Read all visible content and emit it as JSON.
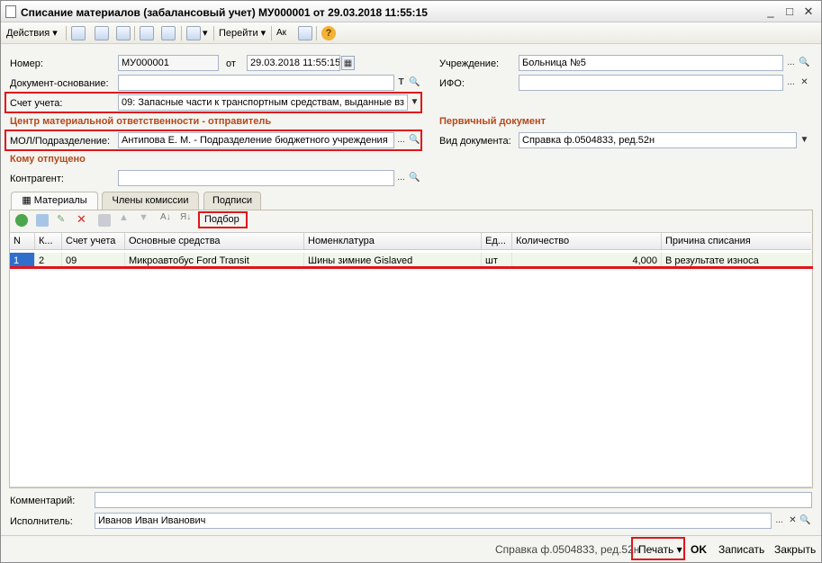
{
  "window": {
    "title": "Списание материалов (забалансовый учет) МУ000001 от 29.03.2018 11:55:15",
    "buttons": {
      "minimize": "_",
      "maximize": "□",
      "close": "✕"
    }
  },
  "toolbar": {
    "actions_label": "Действия",
    "goto_label": "Перейти",
    "help_icon": "?"
  },
  "form": {
    "number_label": "Номер:",
    "number_value": "МУ000001",
    "date_prefix": "от",
    "date_value": "29.03.2018 11:55:15",
    "base_doc_label": "Документ-основание:",
    "base_doc_value": "",
    "account_label": "Счет учета:",
    "account_value": "09: Запасные части к транспортным средствам, выданные вз",
    "sender_section": "Центр материальной ответственности - отправитель",
    "mol_label": "МОЛ/Подразделение:",
    "mol_value": "Антипова Е. М. - Подразделение бюджетного учреждения",
    "recipient_section": "Кому отпущено",
    "counterparty_label": "Контрагент:",
    "counterparty_value": "",
    "institution_label": "Учреждение:",
    "institution_value": "Больница №5",
    "ifo_label": "ИФО:",
    "ifo_value": "",
    "primary_section": "Первичный документ",
    "doc_type_label": "Вид документа:",
    "doc_type_value": "Справка ф.0504833, ред.52н",
    "comment_label": "Комментарий:",
    "comment_value": "",
    "executor_label": "Исполнитель:",
    "executor_value": "Иванов Иван Иванович"
  },
  "tabs": [
    {
      "label": "Материалы"
    },
    {
      "label": "Члены комиссии"
    },
    {
      "label": "Подписи"
    }
  ],
  "table_toolbar": {
    "pick_label": "Подбор"
  },
  "table": {
    "headers": [
      "N",
      "К...",
      "Счет учета",
      "Основные средства",
      "Номенклатура",
      "Ед...",
      "Количество",
      "Причина списания"
    ],
    "rows": [
      [
        "1",
        "2",
        "09",
        "Микроавтобус Ford Transit",
        "Шины зимние Gislaved",
        "шт",
        "4,000",
        "В результате износа"
      ]
    ]
  },
  "footer": {
    "doc_link": "Справка ф.0504833, ред.52н",
    "print_label": "Печать",
    "ok_label": "OK",
    "save_label": "Записать",
    "close_label": "Закрыть"
  },
  "colors": {
    "section": "#b4491b",
    "highlight": "#e0151b",
    "selected_row": "#f0f7ea"
  }
}
